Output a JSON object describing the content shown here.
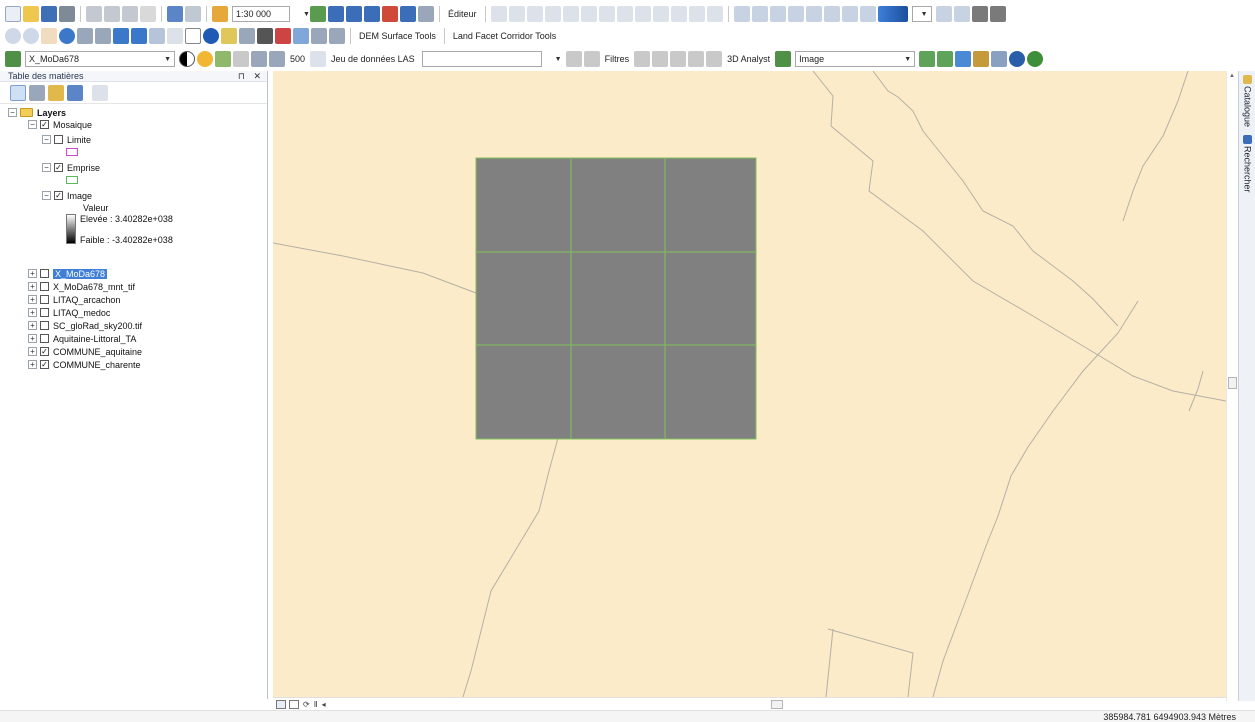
{
  "toolbar": {
    "scale_value": "1:30 000",
    "editor_label": "Éditeur",
    "dem_tools_label": "DEM Surface Tools",
    "land_facet_label": "Land Facet Corridor Tools",
    "layer_combo": "X_MoDa678",
    "cell_size": "500",
    "las_label": "Jeu de données LAS",
    "filters_label": "Filtres",
    "analyst_label": "3D Analyst",
    "analyst_layer": "Image"
  },
  "toc": {
    "title": "Table des matières",
    "close_glyph": "✕",
    "pin_glyph": "⊓",
    "root": "Layers",
    "group": "Mosaique",
    "children": [
      {
        "label": "Limite"
      },
      {
        "label": "Emprise"
      },
      {
        "label": "Image"
      }
    ],
    "legend": {
      "title": "Valeur",
      "high": "Elevée : 3.40282e+038",
      "low": "Faible : -3.40282e+038"
    },
    "layers": [
      {
        "label": "X_MoDa678",
        "checked": false,
        "selected": true
      },
      {
        "label": "X_MoDa678_mnt_tif",
        "checked": false
      },
      {
        "label": "LITAQ_arcachon",
        "checked": false
      },
      {
        "label": "LITAQ_medoc",
        "checked": false
      },
      {
        "label": "SC_gloRad_sky200.tif",
        "checked": false
      },
      {
        "label": "Aquitaine-Littoral_TA",
        "checked": false
      },
      {
        "label": "COMMUNE_aquitaine",
        "checked": true
      },
      {
        "label": "COMMUNE_charente",
        "checked": true
      }
    ]
  },
  "dock": {
    "catalog": "Catalogue",
    "search": "Rechercher"
  },
  "status": {
    "coordinates": "385984.781 6494903.943 Mètres"
  },
  "colors": {
    "map_fill": "#fcebc8",
    "boundary": "#b4b0a6",
    "raster": "#808080",
    "grid_lines": "#7fbf5a",
    "selection": "#3f7fd8"
  }
}
